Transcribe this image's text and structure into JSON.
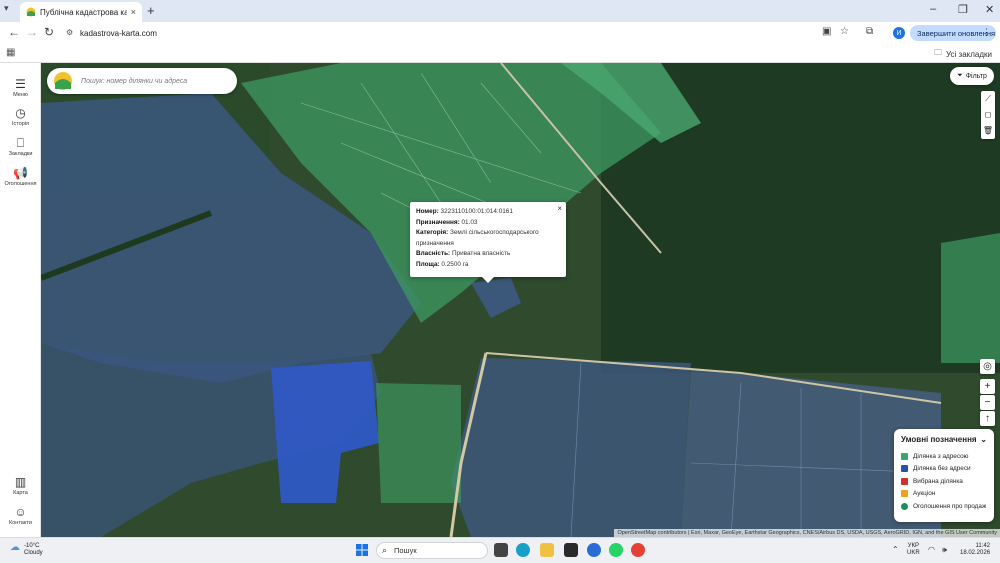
{
  "browser": {
    "tab_title": "Публічна кадастрова карта Ук",
    "tab_close": "×",
    "new_tab": "+",
    "url": "kadastrova-karta.com",
    "profile_initial": "И",
    "update_button": "Завершити оновлення",
    "all_bookmarks": "Усі закладки",
    "window_controls": [
      "–",
      "❐",
      "✕"
    ]
  },
  "sidebar": {
    "items": [
      {
        "label": "Меню",
        "icon": "menu-icon"
      },
      {
        "label": "Історія",
        "icon": "clock-icon"
      },
      {
        "label": "Закладки",
        "icon": "bookmark-icon"
      },
      {
        "label": "Оголошення",
        "icon": "megaphone-icon"
      },
      {
        "label": "Карта",
        "icon": "map-icon"
      },
      {
        "label": "Контакти",
        "icon": "chat-icon"
      }
    ]
  },
  "map": {
    "search_placeholder": "Пошук: номер ділянки чи адреса",
    "filter_label": "Фільтр",
    "attribution": "OpenStreetMap contributors | Esri, Maxar, GeoEye, Earthstar Geographics, CNES/Airbus DS, USDA, USGS, AeroGRID, IGN, and the GIS User Community",
    "zoom_in": "+",
    "zoom_out": "−",
    "reset": "↑",
    "locate": "◎"
  },
  "popup": {
    "number_label": "Номер:",
    "number_value": "3223110100:01:014:0161",
    "purpose_label": "Призначення:",
    "purpose_value": "01.03",
    "category_label": "Категорія:",
    "category_value": "Землі сільськогосподарського призначення",
    "ownership_label": "Власність:",
    "ownership_value": "Приватна власність",
    "area_label": "Площа:",
    "area_value": "0.2500 га",
    "close": "×"
  },
  "legend": {
    "title": "Умовні позначення",
    "items": [
      {
        "label": "Ділянка з адресою",
        "color": "#3aa76d"
      },
      {
        "label": "Ділянка без адреси",
        "color": "#2a4db0"
      },
      {
        "label": "Вибрана ділянка",
        "color": "#d32f2f"
      },
      {
        "label": "Аукціон",
        "color": "#f0a020"
      },
      {
        "label": "Оголошення про продаж",
        "color": "#1e8e5a"
      }
    ]
  },
  "taskbar": {
    "temperature": "-10°C",
    "weather": "Cloudy",
    "search": "Пошук",
    "lang_top": "УКР",
    "lang_bottom": "UKR",
    "time": "11:42",
    "date": "18.02.2026"
  }
}
